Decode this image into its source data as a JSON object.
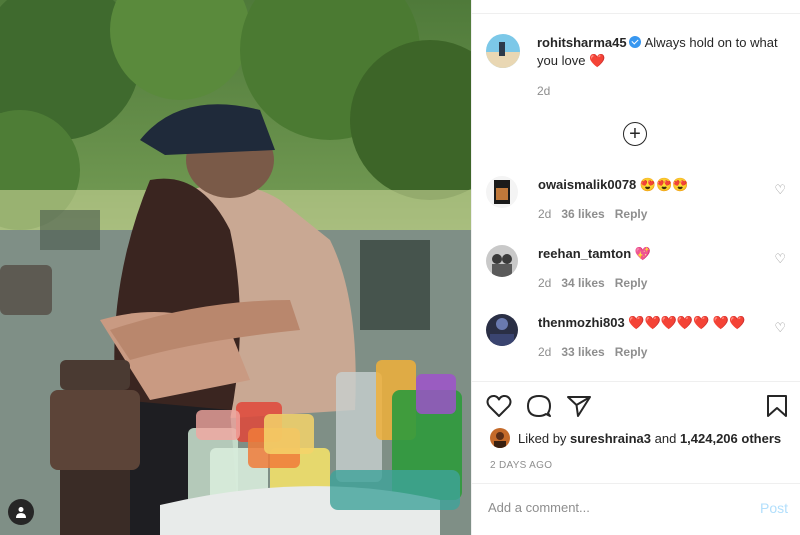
{
  "caption": {
    "username": "rohitsharma45",
    "text": "Always hold on to what you love",
    "heart": "❤️",
    "time": "2d"
  },
  "load_more_icon": "plus-circle-icon",
  "comments": [
    {
      "username": "owaismalik0078",
      "text": "😍😍😍",
      "time": "2d",
      "likes": "36 likes",
      "reply": "Reply"
    },
    {
      "username": "reehan_tamton",
      "text": "💖",
      "time": "2d",
      "likes": "34 likes",
      "reply": "Reply"
    },
    {
      "username": "thenmozhi803",
      "text": "❤️❤️❤️❤️❤️ ❤️❤️",
      "time": "2d",
      "likes": "33 likes",
      "reply": "Reply"
    }
  ],
  "liked_by": {
    "prefix": "Liked by",
    "user": "sureshraina3",
    "and": "and",
    "count": "1,424,206 others"
  },
  "posted": "2 DAYS AGO",
  "add_comment": {
    "placeholder": "Add a comment...",
    "post_label": "Post"
  },
  "colors": {
    "accent": "#3897f0",
    "heart": "#ed4956",
    "muted": "#8e8e8e",
    "post_disabled": "#b2dffc"
  }
}
